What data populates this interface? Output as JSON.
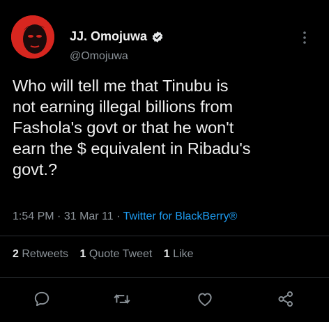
{
  "author": {
    "name": "JJ. Omojuwa",
    "handle": "@Omojuwa",
    "avatar_icon": "profile-avatar"
  },
  "tweet": {
    "text": "Who will tell me that Tinubu is\nnot earning illegal billions from\nFashola's govt or that he won't\nearn the $ equivalent in Ribadu's\ngovt.?"
  },
  "meta": {
    "time": "1:54 PM",
    "separator": "·",
    "date": "31 Mar 11",
    "source": "Twitter for BlackBerry®"
  },
  "stats": {
    "retweets_count": "2",
    "retweets_label": "Retweets",
    "quotes_count": "1",
    "quotes_label": "Quote Tweet",
    "likes_count": "1",
    "likes_label": "Like"
  },
  "actions": [
    "reply-icon",
    "retweet-icon",
    "like-icon",
    "share-icon"
  ],
  "colors": {
    "background": "#000000",
    "text": "#e7e9ea",
    "secondary": "#8b9298",
    "accent": "#1d9bf0",
    "avatar": "#d7261f"
  }
}
